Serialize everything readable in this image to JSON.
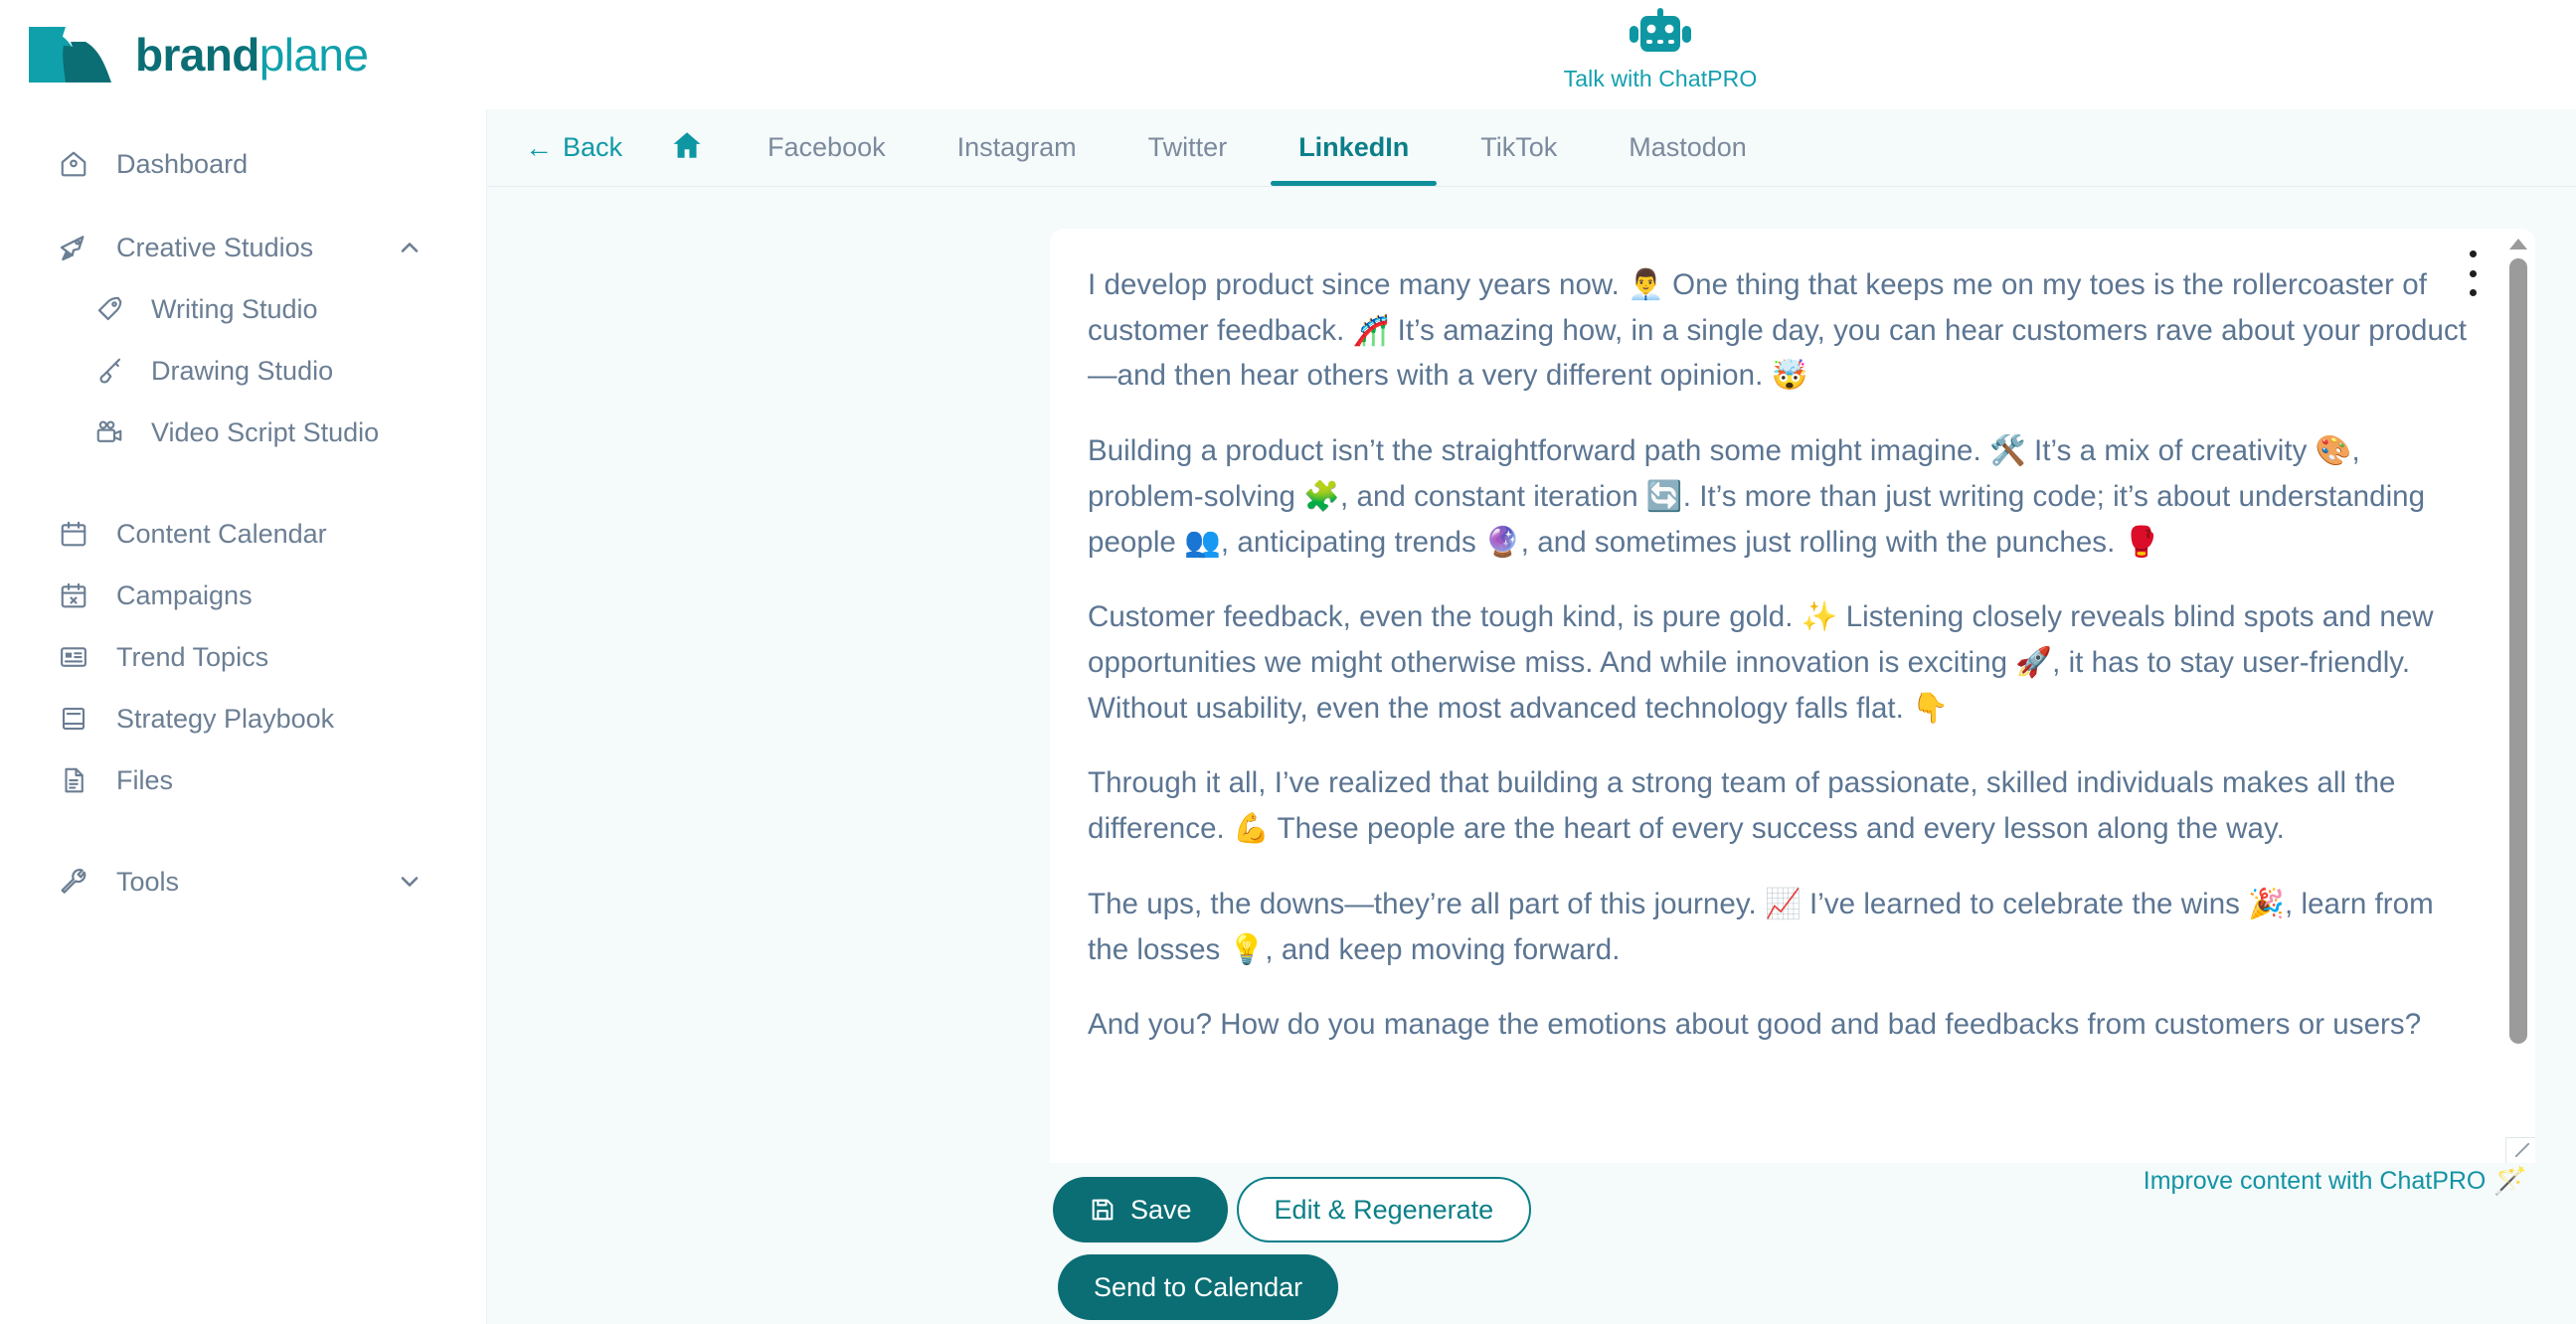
{
  "brand": {
    "name_bold": "brand",
    "name_light": "plane",
    "logo_icon": "brandplane-logo-icon"
  },
  "chatpro": {
    "label": "Talk with ChatPRO",
    "icon": "robot-icon"
  },
  "sidebar": {
    "items": [
      {
        "label": "Dashboard",
        "icon": "home-icon",
        "level": 0
      },
      {
        "label": "Creative Studios",
        "icon": "rocket-icon",
        "level": 0,
        "chevron": "chevron-up-icon"
      },
      {
        "label": "Writing Studio",
        "icon": "pen-nib-icon",
        "level": 1
      },
      {
        "label": "Drawing Studio",
        "icon": "paint-brush-icon",
        "level": 1
      },
      {
        "label": "Video Script Studio",
        "icon": "video-camera-icon",
        "level": 1
      },
      {
        "label": "Content Calendar",
        "icon": "calendar-icon",
        "level": 0
      },
      {
        "label": "Campaigns",
        "icon": "calendar-x-icon",
        "level": 0
      },
      {
        "label": "Trend Topics",
        "icon": "news-card-icon",
        "level": 0
      },
      {
        "label": "Strategy Playbook",
        "icon": "book-icon",
        "level": 0
      },
      {
        "label": "Files",
        "icon": "file-text-icon",
        "level": 0
      },
      {
        "label": "Tools",
        "icon": "wrench-icon",
        "level": 0,
        "chevron": "chevron-down-icon"
      }
    ]
  },
  "tabbar": {
    "back_label": "Back",
    "back_icon": "arrow-left-icon",
    "home_icon": "home-icon",
    "tabs": [
      {
        "label": "Facebook",
        "active": false
      },
      {
        "label": "Instagram",
        "active": false
      },
      {
        "label": "Twitter",
        "active": false
      },
      {
        "label": "LinkedIn",
        "active": true
      },
      {
        "label": "TikTok",
        "active": false
      },
      {
        "label": "Mastodon",
        "active": false
      }
    ]
  },
  "content": {
    "paragraphs": [
      "I develop product since many years now. 👨‍💼 One thing that keeps me on my toes is the rollercoaster of customer feedback. 🎢 It’s amazing how, in a single day, you can hear customers rave about your product—and then hear others with a very different opinion. 🤯",
      "Building a product isn’t the straightforward path some might imagine. 🛠️ It’s a mix of creativity 🎨, problem-solving 🧩, and constant iteration 🔄. It’s more than just writing code; it’s about understanding people 👥, anticipating trends 🔮, and sometimes just rolling with the punches. 🥊",
      "Customer feedback, even the tough kind, is pure gold. ✨ Listening closely reveals blind spots and new opportunities we might otherwise miss. And while innovation is exciting 🚀, it has to stay user-friendly. Without usability, even the most advanced technology falls flat. 👇",
      "Through it all, I’ve realized that building a strong team of passionate, skilled individuals makes all the difference. 💪 These people are the heart of every success and every lesson along the way.",
      "The ups, the downs—they’re all part of this journey. 📈 I’ve learned to celebrate the wins 🎉, learn from the losses 💡, and keep moving forward.",
      "And you? How do you manage the emotions about good and bad feedbacks from customers or users?"
    ],
    "kebab_icon": "more-vertical-icon",
    "scrollbar": {
      "up_icon": "scroll-up-arrow-icon",
      "down_icon": "scroll-down-arrow-icon"
    }
  },
  "actions": {
    "save_label": "Save",
    "save_icon": "floppy-disk-icon",
    "edit_label": "Edit & Regenerate",
    "send_label": "Send to Calendar",
    "improve_label": "Improve content with ChatPRO",
    "improve_icon": "🪄"
  },
  "colors": {
    "brand_dark": "#0b6e75",
    "brand_teal": "#0fa0ab",
    "accent": "#0e8f99",
    "text_muted": "#6b7e93",
    "body_text": "#5b7592",
    "page_bg": "#f5fafb"
  }
}
